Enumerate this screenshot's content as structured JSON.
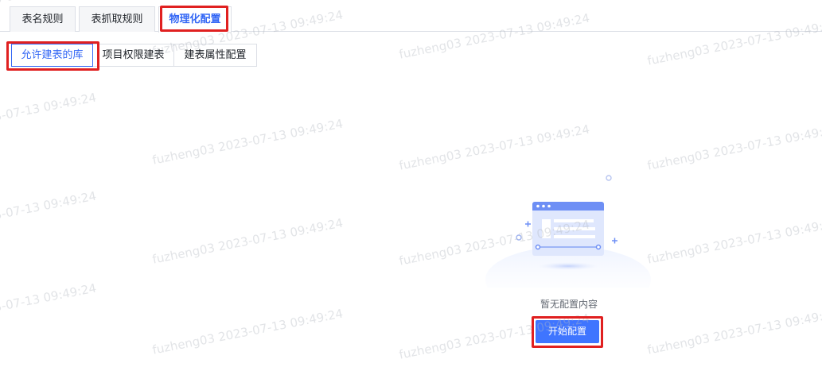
{
  "tabs": {
    "items": [
      {
        "label": "表名规则"
      },
      {
        "label": "表抓取规则"
      },
      {
        "label": "物理化配置"
      }
    ],
    "active_index": 2
  },
  "subtabs": {
    "items": [
      {
        "label": "允许建表的库"
      },
      {
        "label": "项目权限建表"
      },
      {
        "label": "建表属性配置"
      }
    ],
    "active_index": 0
  },
  "empty_state": {
    "icon": "empty-window-illustration",
    "text": "暂无配置内容",
    "button_label": "开始配置"
  },
  "watermark": {
    "text": "fuzheng03 2023-07-13 09:49:24"
  },
  "colors": {
    "accent": "#3367f5",
    "button": "#3f75ff",
    "highlight": "#e02020"
  }
}
